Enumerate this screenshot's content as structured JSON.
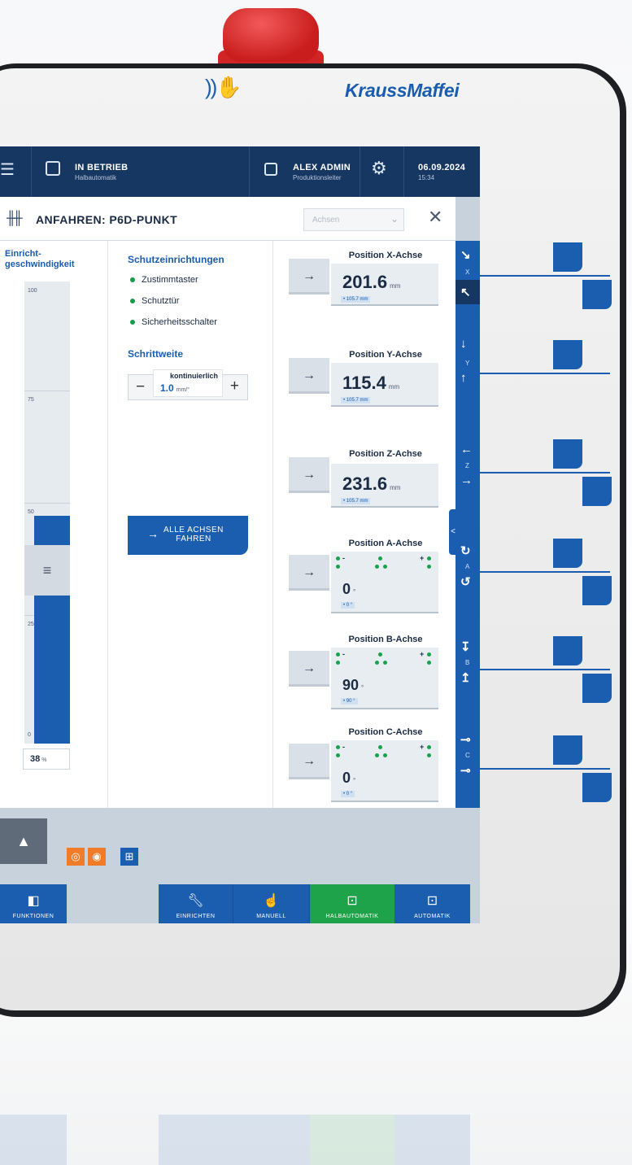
{
  "device": {
    "brand": "KraussMaffei",
    "nfc_icon": "nfc-hand-icon"
  },
  "topbar": {
    "status_title": "IN BETRIEB",
    "status_sub": "Halbautomatik",
    "user_name": "ALEX ADMIN",
    "user_role": "Produktionsleiter",
    "date": "06.09.2024",
    "time": "15:34"
  },
  "header": {
    "title": "ANFAHREN: P6D-PUNKT",
    "axes_select_placeholder": "Achsen",
    "close_glyph": "✕"
  },
  "speed": {
    "title_line1": "Einricht-",
    "title_line2": "geschwindigkeit",
    "ticks": [
      "100",
      "75",
      "50",
      "25",
      "0"
    ],
    "value": "38",
    "unit": "%",
    "level_percent": 38
  },
  "safety": {
    "heading": "Schutzeinrichtungen",
    "items": [
      "Zustimmtaster",
      "Schutztür",
      "Sicherheitsschalter"
    ]
  },
  "step": {
    "heading": "Schrittweite",
    "mode": "kontinuierlich",
    "value": "1.0",
    "unit": "mm/°",
    "minus": "−",
    "plus": "+"
  },
  "move_all": {
    "label_line1": "ALLE ACHSEN",
    "label_line2": "FAHREN",
    "arrow": "→"
  },
  "axes": [
    {
      "title": "Position X-Achse",
      "value": "201.6",
      "unit": "mm",
      "chip": "• 105.7 mm"
    },
    {
      "title": "Position Y-Achse",
      "value": "115.4",
      "unit": "mm",
      "chip": "• 105.7 mm"
    },
    {
      "title": "Position Z-Achse",
      "value": "231.6",
      "unit": "mm",
      "chip": "• 105.7 mm"
    },
    {
      "title": "Position A-Achse",
      "value": "0",
      "unit": "°",
      "chip": "• 0 °"
    },
    {
      "title": "Position B-Achse",
      "value": "90",
      "unit": "°",
      "chip": "• 90 °"
    },
    {
      "title": "Position C-Achse",
      "value": "0",
      "unit": "°",
      "chip": "• 0 °"
    }
  ],
  "jog": {
    "axis_letters": [
      "X",
      "Y",
      "Z",
      "A",
      "B",
      "C"
    ],
    "tab_glyph": "<"
  },
  "bottom": {
    "alarm_glyph": "▲",
    "functions_label": "FUNKTIONEN",
    "modes": [
      "EINRICHTEN",
      "MANUELL",
      "HALBAUTOMATIK",
      "AUTOMATIK"
    ],
    "active_mode": "HALBAUTOMATIK"
  },
  "colors": {
    "primary": "#1b5eb0",
    "dark": "#173763",
    "active": "#1fa34a",
    "estop": "#d12424",
    "quick_orange": "#f07b28"
  }
}
